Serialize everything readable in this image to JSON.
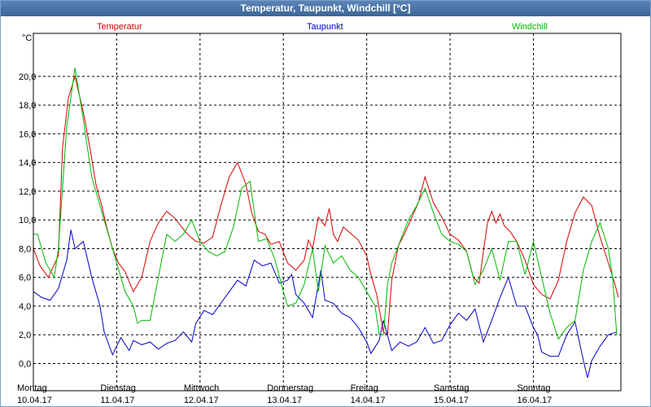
{
  "window": {
    "title": "Temperatur, Taupunkt, Windchill [°C]"
  },
  "chart_data": {
    "type": "line",
    "title": "Temperatur, Taupunkt, Windchill [°C]",
    "ylabel": "°C",
    "ylim": [
      -1.9,
      23.0
    ],
    "xlim": [
      0,
      7.05
    ],
    "grid": true,
    "legend_placement": "top",
    "yticks": [
      "20,0",
      "18,0",
      "16,0",
      "14,0",
      "12,0",
      "10,0",
      "8,0",
      "6,0",
      "4,0",
      "2,0",
      "0,0"
    ],
    "ytick_values": [
      20,
      18,
      16,
      14,
      12,
      10,
      8,
      6,
      4,
      2,
      0
    ],
    "xtick_values": [
      0,
      1,
      2,
      3,
      4,
      5,
      6
    ],
    "xtick_days": [
      "Montag",
      "Dienstag",
      "Mittwoch",
      "Donnerstag",
      "Freitag",
      "Samstag",
      "Sonntag"
    ],
    "xtick_dates": [
      "10.04.17",
      "11.04.17",
      "12.04.17",
      "13.04.17",
      "14.04.17",
      "15.04.17",
      "16.04.17"
    ],
    "series": [
      {
        "name": "Temperatur",
        "color": "#d40000",
        "x": [
          0,
          0.08,
          0.18,
          0.3,
          0.35,
          0.42,
          0.5,
          0.6,
          0.68,
          0.75,
          0.82,
          0.88,
          0.95,
          1.02,
          1.1,
          1.2,
          1.3,
          1.4,
          1.5,
          1.6,
          1.7,
          1.78,
          1.85,
          1.95,
          2.05,
          2.15,
          2.25,
          2.35,
          2.45,
          2.55,
          2.62,
          2.7,
          2.78,
          2.85,
          2.95,
          3.05,
          3.15,
          3.25,
          3.3,
          3.35,
          3.42,
          3.5,
          3.55,
          3.6,
          3.65,
          3.72,
          3.8,
          3.9,
          4.0,
          4.05,
          4.12,
          4.2,
          4.25,
          4.3,
          4.38,
          4.45,
          4.55,
          4.62,
          4.7,
          4.8,
          4.9,
          5.0,
          5.1,
          5.2,
          5.28,
          5.35,
          5.4,
          5.45,
          5.5,
          5.55,
          5.6,
          5.65,
          5.72,
          5.8,
          5.9,
          6.0,
          6.1,
          6.2,
          6.3,
          6.4,
          6.5,
          6.6,
          6.7,
          6.8,
          6.9,
          6.98,
          7.02
        ],
        "y": [
          8.0,
          6.8,
          6.0,
          7.5,
          15.0,
          18.5,
          20.0,
          17.5,
          15.0,
          12.5,
          11.0,
          9.5,
          8.0,
          7.0,
          6.4,
          5.0,
          6.0,
          8.5,
          9.8,
          10.6,
          10.1,
          9.5,
          9.0,
          8.5,
          8.4,
          8.8,
          11.0,
          13.0,
          14.0,
          12.5,
          10.5,
          9.2,
          9.0,
          8.3,
          8.5,
          7.0,
          6.5,
          7.2,
          8.6,
          8.0,
          10.2,
          9.6,
          10.8,
          9.0,
          8.5,
          9.5,
          9.1,
          8.6,
          7.5,
          6.2,
          4.8,
          2.2,
          2.0,
          5.8,
          8.2,
          9.0,
          10.3,
          11.2,
          13.0,
          11.2,
          10.2,
          9.0,
          8.6,
          7.8,
          6.0,
          5.6,
          7.8,
          9.8,
          10.6,
          9.8,
          10.4,
          9.6,
          9.2,
          8.5,
          7.2,
          5.5,
          4.8,
          4.5,
          5.8,
          8.5,
          10.5,
          11.6,
          11.0,
          8.8,
          7.0,
          5.5,
          4.6
        ]
      },
      {
        "name": "Taupunkt",
        "color": "#0000cc",
        "x": [
          0,
          0.1,
          0.2,
          0.3,
          0.4,
          0.45,
          0.5,
          0.6,
          0.7,
          0.8,
          0.85,
          0.95,
          1.05,
          1.15,
          1.2,
          1.3,
          1.4,
          1.5,
          1.6,
          1.7,
          1.8,
          1.9,
          1.95,
          2.05,
          2.15,
          2.25,
          2.35,
          2.45,
          2.55,
          2.65,
          2.75,
          2.85,
          2.95,
          3.05,
          3.1,
          3.15,
          3.25,
          3.35,
          3.45,
          3.5,
          3.55,
          3.6,
          3.7,
          3.8,
          3.9,
          4.0,
          4.05,
          4.15,
          4.2,
          4.3,
          4.4,
          4.5,
          4.6,
          4.7,
          4.8,
          4.9,
          5.0,
          5.1,
          5.2,
          5.3,
          5.4,
          5.5,
          5.6,
          5.7,
          5.8,
          5.9,
          6.0,
          6.05,
          6.1,
          6.2,
          6.3,
          6.4,
          6.5,
          6.6,
          6.65,
          6.7,
          6.8,
          6.9,
          7.0
        ],
        "y": [
          5.0,
          4.6,
          4.4,
          5.2,
          7.2,
          9.3,
          8.0,
          8.5,
          6.0,
          4.0,
          2.2,
          0.6,
          1.8,
          0.9,
          1.6,
          1.3,
          1.5,
          1.0,
          1.4,
          1.6,
          2.2,
          1.5,
          2.8,
          3.7,
          3.4,
          4.2,
          5.0,
          5.8,
          5.4,
          7.2,
          6.8,
          7.0,
          5.6,
          5.8,
          6.2,
          4.8,
          4.2,
          3.2,
          6.5,
          4.4,
          4.3,
          4.2,
          3.5,
          3.2,
          2.5,
          1.5,
          0.7,
          1.6,
          3.0,
          0.9,
          1.5,
          1.2,
          1.5,
          2.5,
          1.4,
          1.6,
          2.7,
          3.5,
          3.0,
          3.8,
          1.5,
          3.0,
          4.6,
          6.0,
          4.0,
          4.0,
          2.5,
          2.0,
          0.8,
          0.5,
          0.5,
          2.0,
          2.9,
          0.2,
          -1.0,
          0.2,
          1.2,
          2.0,
          2.2
        ]
      },
      {
        "name": "Windchill",
        "color": "#00b800",
        "x": [
          0,
          0.05,
          0.15,
          0.25,
          0.3,
          0.4,
          0.5,
          0.6,
          0.7,
          0.8,
          0.9,
          1.0,
          1.1,
          1.2,
          1.25,
          1.3,
          1.4,
          1.5,
          1.55,
          1.6,
          1.7,
          1.8,
          1.9,
          2.0,
          2.1,
          2.2,
          2.3,
          2.4,
          2.5,
          2.6,
          2.7,
          2.8,
          2.9,
          3.0,
          3.05,
          3.15,
          3.25,
          3.35,
          3.42,
          3.5,
          3.6,
          3.7,
          3.8,
          3.9,
          4.0,
          4.1,
          4.15,
          4.2,
          4.25,
          4.3,
          4.4,
          4.5,
          4.6,
          4.7,
          4.8,
          4.9,
          5.0,
          5.1,
          5.2,
          5.3,
          5.4,
          5.5,
          5.6,
          5.7,
          5.8,
          5.9,
          6.0,
          6.1,
          6.2,
          6.3,
          6.4,
          6.5,
          6.6,
          6.7,
          6.8,
          6.9,
          6.95,
          7.0
        ],
        "y": [
          9.0,
          9.0,
          7.0,
          6.0,
          8.0,
          16.5,
          20.6,
          17.0,
          13.0,
          11.0,
          9.0,
          7.0,
          5.0,
          4.0,
          2.8,
          3.0,
          3.0,
          6.0,
          7.5,
          9.0,
          8.5,
          9.0,
          10.0,
          8.5,
          7.8,
          7.5,
          7.8,
          9.5,
          12.2,
          12.7,
          8.5,
          8.7,
          7.2,
          5.0,
          4.0,
          4.2,
          5.5,
          8.0,
          5.0,
          8.2,
          7.0,
          7.5,
          6.5,
          6.0,
          5.0,
          4.0,
          2.0,
          2.0,
          5.5,
          7.0,
          8.5,
          10.0,
          11.0,
          12.2,
          10.5,
          9.0,
          8.5,
          8.3,
          7.8,
          5.5,
          6.5,
          8.0,
          5.8,
          8.5,
          8.5,
          6.2,
          8.5,
          6.0,
          3.5,
          1.7,
          2.5,
          3.0,
          6.5,
          8.5,
          9.8,
          8.0,
          6.0,
          2.0
        ]
      }
    ]
  }
}
